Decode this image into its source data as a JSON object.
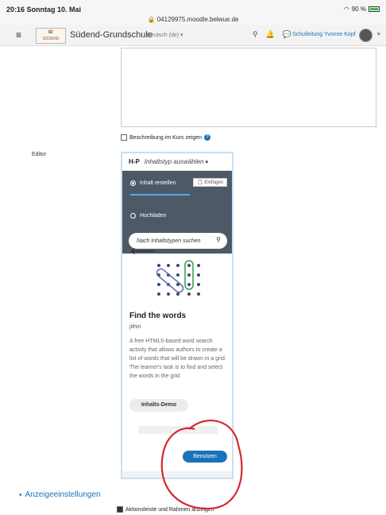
{
  "status_bar": {
    "time_date": "20:16  Sonntag 10. Mai",
    "battery": "90 %"
  },
  "browser": {
    "url": "04129975.moodle.belwue.de"
  },
  "navbar": {
    "site_name": "Südend-Grundschule",
    "language": "Deutsch (de)",
    "user_name": "Schulleitung Yvonne Kopf",
    "logo_text": "SÜDEND GRUNDSCHULE"
  },
  "form": {
    "show_description_label": "Beschreibung im Kurs zeigen",
    "editor_label": "Editor",
    "section_title": "Anzeigeeinstellungen",
    "action_bar_label": "Aktionsleiste und Rahmen anzeigen"
  },
  "h5p": {
    "logo": "H-P",
    "select_label": "Inhaltstyp auswählen",
    "create_label": "Inhalt erstellen",
    "paste_label": "Einfügen",
    "upload_label": "Hochladen",
    "search_placeholder": "Nach Inhaltstypen suchen",
    "item": {
      "title": "Find the words",
      "author": "jithin",
      "description": "A free HTML5-based word search activity that allows authors to create a list of words that will be drawn in a grid. The learner's task is to find and select the words in the grid."
    },
    "demo_button": "Inhalts-Demo",
    "use_button": "Benutzen"
  },
  "colors": {
    "accent": "#1a73b8",
    "dark_panel": "#4d5966",
    "annotation": "#d8262f"
  }
}
